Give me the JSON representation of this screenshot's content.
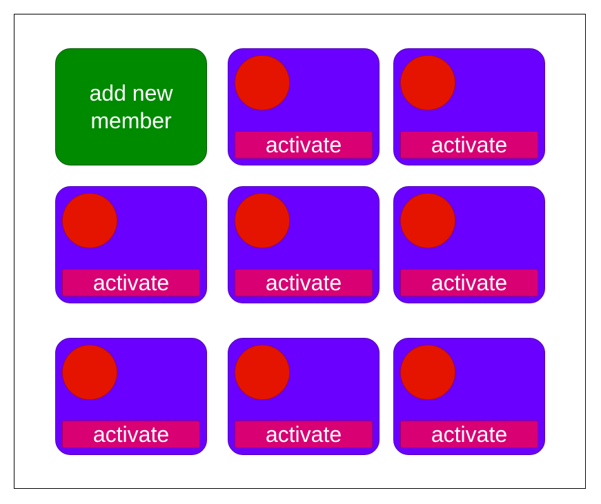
{
  "colors": {
    "add_card": "#008a00",
    "member_card": "#6a00ff",
    "avatar": "#e51400",
    "activate_button": "#d80073",
    "text": "#ffffff"
  },
  "add_card": {
    "label": "add new\nmember"
  },
  "members": [
    {
      "avatar_icon": "avatar-circle",
      "button_label": "activate"
    },
    {
      "avatar_icon": "avatar-circle",
      "button_label": "activate"
    },
    {
      "avatar_icon": "avatar-circle",
      "button_label": "activate"
    },
    {
      "avatar_icon": "avatar-circle",
      "button_label": "activate"
    },
    {
      "avatar_icon": "avatar-circle",
      "button_label": "activate"
    },
    {
      "avatar_icon": "avatar-circle",
      "button_label": "activate"
    },
    {
      "avatar_icon": "avatar-circle",
      "button_label": "activate"
    },
    {
      "avatar_icon": "avatar-circle",
      "button_label": "activate"
    }
  ]
}
